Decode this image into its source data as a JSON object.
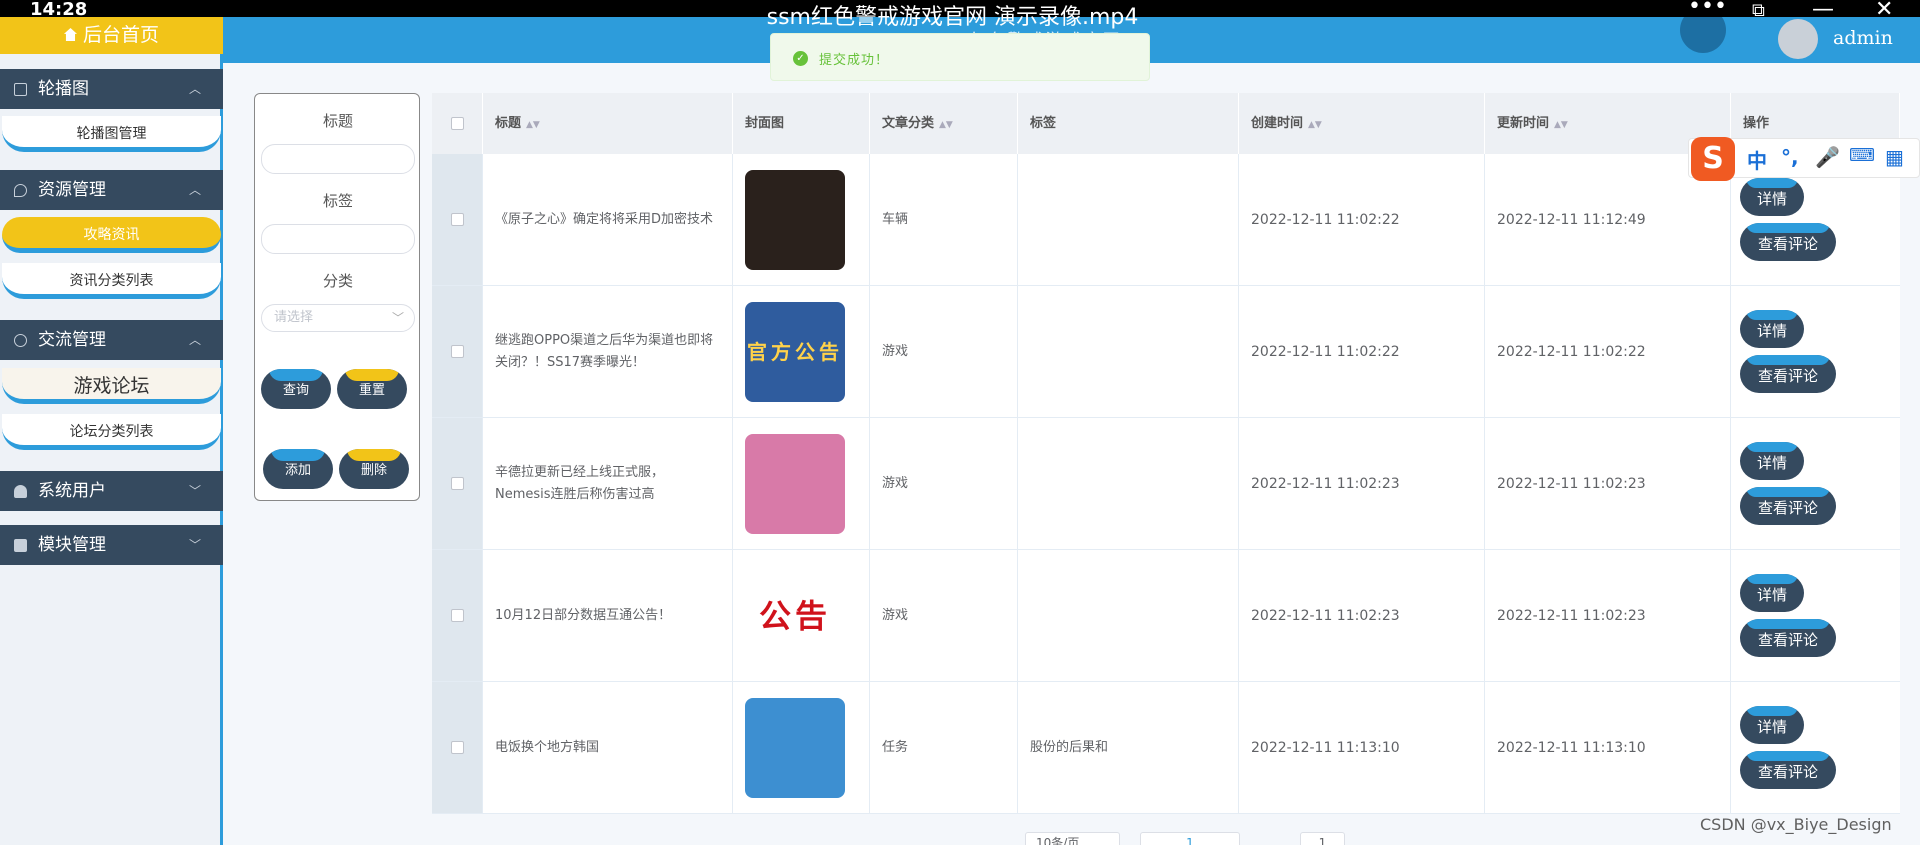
{
  "video": {
    "clock": "14:28",
    "title": "ssm红色警戒游戏官网 演示录像.mp4"
  },
  "header": {
    "subtitle": "ssm红色警戒游戏官网",
    "username": "admin"
  },
  "toast": {
    "message": "提交成功！"
  },
  "sidebar": {
    "home": "后台首页",
    "groups": [
      {
        "label": "轮播图",
        "items": [
          "轮播图管理"
        ]
      },
      {
        "label": "资源管理",
        "items": [
          "攻略资讯",
          "资讯分类列表"
        ]
      },
      {
        "label": "交流管理",
        "items": [
          "游戏论坛",
          "论坛分类列表"
        ]
      },
      {
        "label": "系统用户",
        "items": []
      },
      {
        "label": "模块管理",
        "items": []
      }
    ]
  },
  "search": {
    "title_label": "标题",
    "tag_label": "标签",
    "category_label": "分类",
    "category_placeholder": "请选择",
    "query_btn": "查询",
    "reset_btn": "重置",
    "add_btn": "添加",
    "delete_btn": "删除"
  },
  "table": {
    "headers": [
      "标题",
      "封面图",
      "文章分类",
      "标签",
      "创建时间",
      "更新时间",
      "操作"
    ],
    "rows": [
      {
        "title": "《原子之心》确定将将采用D加密技术",
        "category": "车辆",
        "tag": "",
        "created": "2022-12-11 11:02:22",
        "updated": "2022-12-11 11:12:49",
        "cover_color": "#2a211c"
      },
      {
        "title": "继逃跑OPPO渠道之后华为渠道也即将关闭？！SS17赛季曝光！",
        "category": "游戏",
        "tag": "",
        "created": "2022-12-11 11:02:22",
        "updated": "2022-12-11 11:02:22",
        "cover_color": "#2f5c9e",
        "cover_text": "官方公告"
      },
      {
        "title": "辛德拉更新已经上线正式服，Nemesis连胜后称伤害过高",
        "category": "游戏",
        "tag": "",
        "created": "2022-12-11 11:02:23",
        "updated": "2022-12-11 11:02:23",
        "cover_color": "#d87aa8"
      },
      {
        "title": "10月12日部分数据互通公告！",
        "category": "游戏",
        "tag": "",
        "created": "2022-12-11 11:02:23",
        "updated": "2022-12-11 11:02:23",
        "cover_color": "#ffffff",
        "cover_text": "公告"
      },
      {
        "title": "电饭换个地方韩国",
        "category": "任务",
        "tag": "股份的后果和",
        "created": "2022-12-11 11:13:10",
        "updated": "2022-12-11 11:13:10",
        "cover_color": "#3d8fd1"
      }
    ],
    "detail_btn": "详情",
    "comment_btn": "查看评论"
  },
  "pager": {
    "page_size": "10条/页",
    "current_page": "1"
  },
  "ime": {
    "logo": "S",
    "mode": "中",
    "punct": "°,"
  },
  "watermark": "CSDN @vx_Biye_Design"
}
